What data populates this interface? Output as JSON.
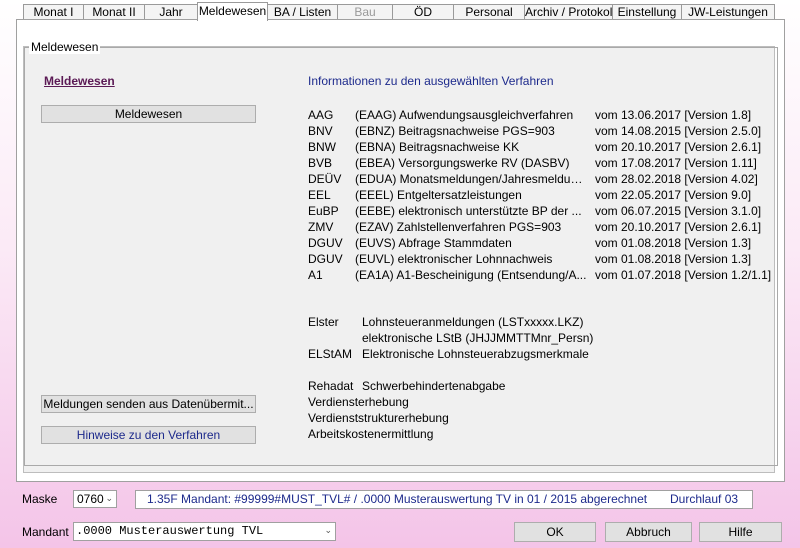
{
  "tabs": [
    {
      "label": "Monat I"
    },
    {
      "label": "Monat II"
    },
    {
      "label": "Jahr"
    },
    {
      "label": "Meldewesen"
    },
    {
      "label": "BA / Listen"
    },
    {
      "label": "Bau"
    },
    {
      "label": "ÖD"
    },
    {
      "label": "Personal"
    },
    {
      "label": "Archiv / Protokoll"
    },
    {
      "label": "Einstellung"
    },
    {
      "label": "JW-Leistungen"
    }
  ],
  "group_label": "Meldewesen",
  "section_title": "Meldewesen",
  "buttons": {
    "meldewesen": "Meldewesen",
    "senden": "Meldungen senden aus Datenübermit...",
    "hinweise": "Hinweise zu den Verfahren"
  },
  "info_title": "Informationen zu den ausgewählten Verfahren",
  "procedures": [
    {
      "code": "AAG",
      "desc": "(EAAG) Aufwendungsausgleichverfahren",
      "version": "vom 13.06.2017 [Version 1.8]"
    },
    {
      "code": "BNV",
      "desc": "(EBNZ) Beitragsnachweise PGS=903",
      "version": "vom 14.08.2015 [Version 2.5.0]"
    },
    {
      "code": "BNW",
      "desc": "(EBNA) Beitragsnachweise KK",
      "version": "vom 20.10.2017 [Version 2.6.1]"
    },
    {
      "code": "BVB",
      "desc": "(EBEA) Versorgungswerke RV (DASBV)",
      "version": "vom 17.08.2017 [Version 1.11]"
    },
    {
      "code": "DEÜV",
      "desc": "(EDUA) Monatsmeldungen/Jahresmeldun...",
      "version": "vom 28.02.2018 [Version 4.02]"
    },
    {
      "code": "EEL",
      "desc": "(EEEL) Entgeltersatzleistungen",
      "version": "vom 22.05.2017 [Version 9.0]"
    },
    {
      "code": "EuBP",
      "desc": "(EEBE) elektronisch unterstützte BP der ...",
      "version": "vom 06.07.2015 [Version 3.1.0]"
    },
    {
      "code": "ZMV",
      "desc": "(EZAV) Zahlstellenverfahren PGS=903",
      "version": "vom 20.10.2017 [Version 2.6.1]"
    },
    {
      "code": "DGUV",
      "desc": "(EUVS) Abfrage Stammdaten",
      "version": "vom 01.08.2018 [Version 1.3]"
    },
    {
      "code": "DGUV",
      "desc": "(EUVL) elektronischer Lohnnachweis",
      "version": "vom 01.08.2018 [Version 1.3]"
    },
    {
      "code": "A1",
      "desc": "(EA1A) A1-Bescheinigung (Entsendung/A...",
      "version": "vom 01.07.2018 [Version 1.2/1.1]"
    }
  ],
  "elster": {
    "label": "Elster",
    "line1": "Lohnsteueranmeldungen (LSTxxxxx.LKZ)",
    "line2": "elektronische LStB (JHJJMMTTMnr_Persn)"
  },
  "elstam": {
    "label": "ELStAM",
    "text": "Elektronische Lohnsteuerabzugsmerkmale"
  },
  "rehadat": {
    "label": "Rehadat",
    "text": "Schwerbehindertenabgabe"
  },
  "extra_lines": [
    "Verdiensterhebung",
    "Verdienststrukturerhebung",
    "Arbeitskostenermittlung"
  ],
  "bottom": {
    "maske_label": "Maske",
    "maske_value": "0760",
    "status_text": "1.35F Mandant: #99999#MUST_TVL# / .0000 Musterauswertung TV in 01 / 2015 abgerechnet",
    "durchlauf": "Durchlauf 03",
    "mandant_label": "Mandant",
    "mandant_value": ".0000 Musterauswertung TVL",
    "ok": "OK",
    "abbruch": "Abbruch",
    "hilfe": "Hilfe"
  }
}
